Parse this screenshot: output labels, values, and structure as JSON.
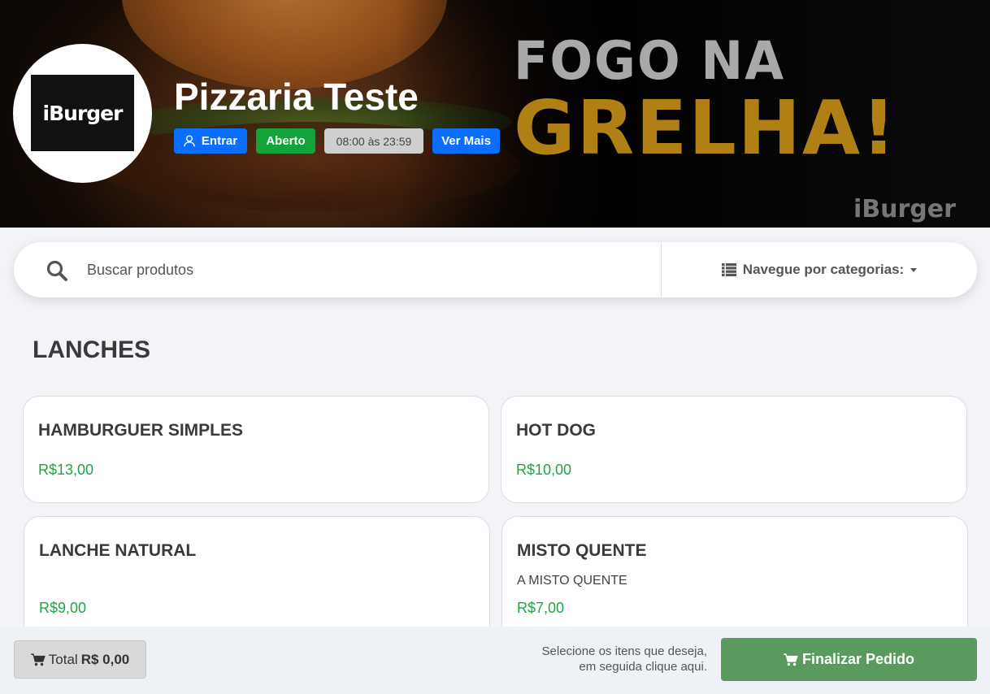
{
  "header": {
    "store_name": "Pizzaria Teste",
    "login_label": "Entrar",
    "status_label": "Aberto",
    "hours_label": "08:00 às 23:59",
    "more_label": "Ver Mais",
    "logo_text": "iBurger",
    "banner": {
      "line1": "FOGO NA",
      "line2": "GRELHA!",
      "watermark": "iBurger"
    }
  },
  "search": {
    "placeholder": "Buscar produtos",
    "categories_label": "Navegue por categorias:"
  },
  "category": {
    "title": "LANCHES",
    "products": [
      {
        "name": "HAMBURGUER SIMPLES",
        "description": "",
        "price": "R$13,00"
      },
      {
        "name": "HOT DOG",
        "description": "",
        "price": "R$10,00"
      },
      {
        "name": "LANCHE NATURAL",
        "description": "",
        "price": "R$9,00"
      },
      {
        "name": "MISTO QUENTE",
        "description": "A MISTO QUENTE",
        "price": "R$7,00"
      }
    ]
  },
  "footer": {
    "total_label": "Total",
    "total_value": "R$ 0,00",
    "hint_line1": "Selecione os itens que deseja,",
    "hint_line2": "em seguida clique aqui.",
    "finish_label": "Finalizar Pedido"
  },
  "colors": {
    "primary_blue": "#0b6efd",
    "open_green": "#12a33a",
    "price_green": "#21a247",
    "finish_green": "#5a9a5e"
  },
  "icons": [
    "user-icon",
    "search-icon",
    "list-icon",
    "caret-down-icon",
    "cart-icon"
  ]
}
